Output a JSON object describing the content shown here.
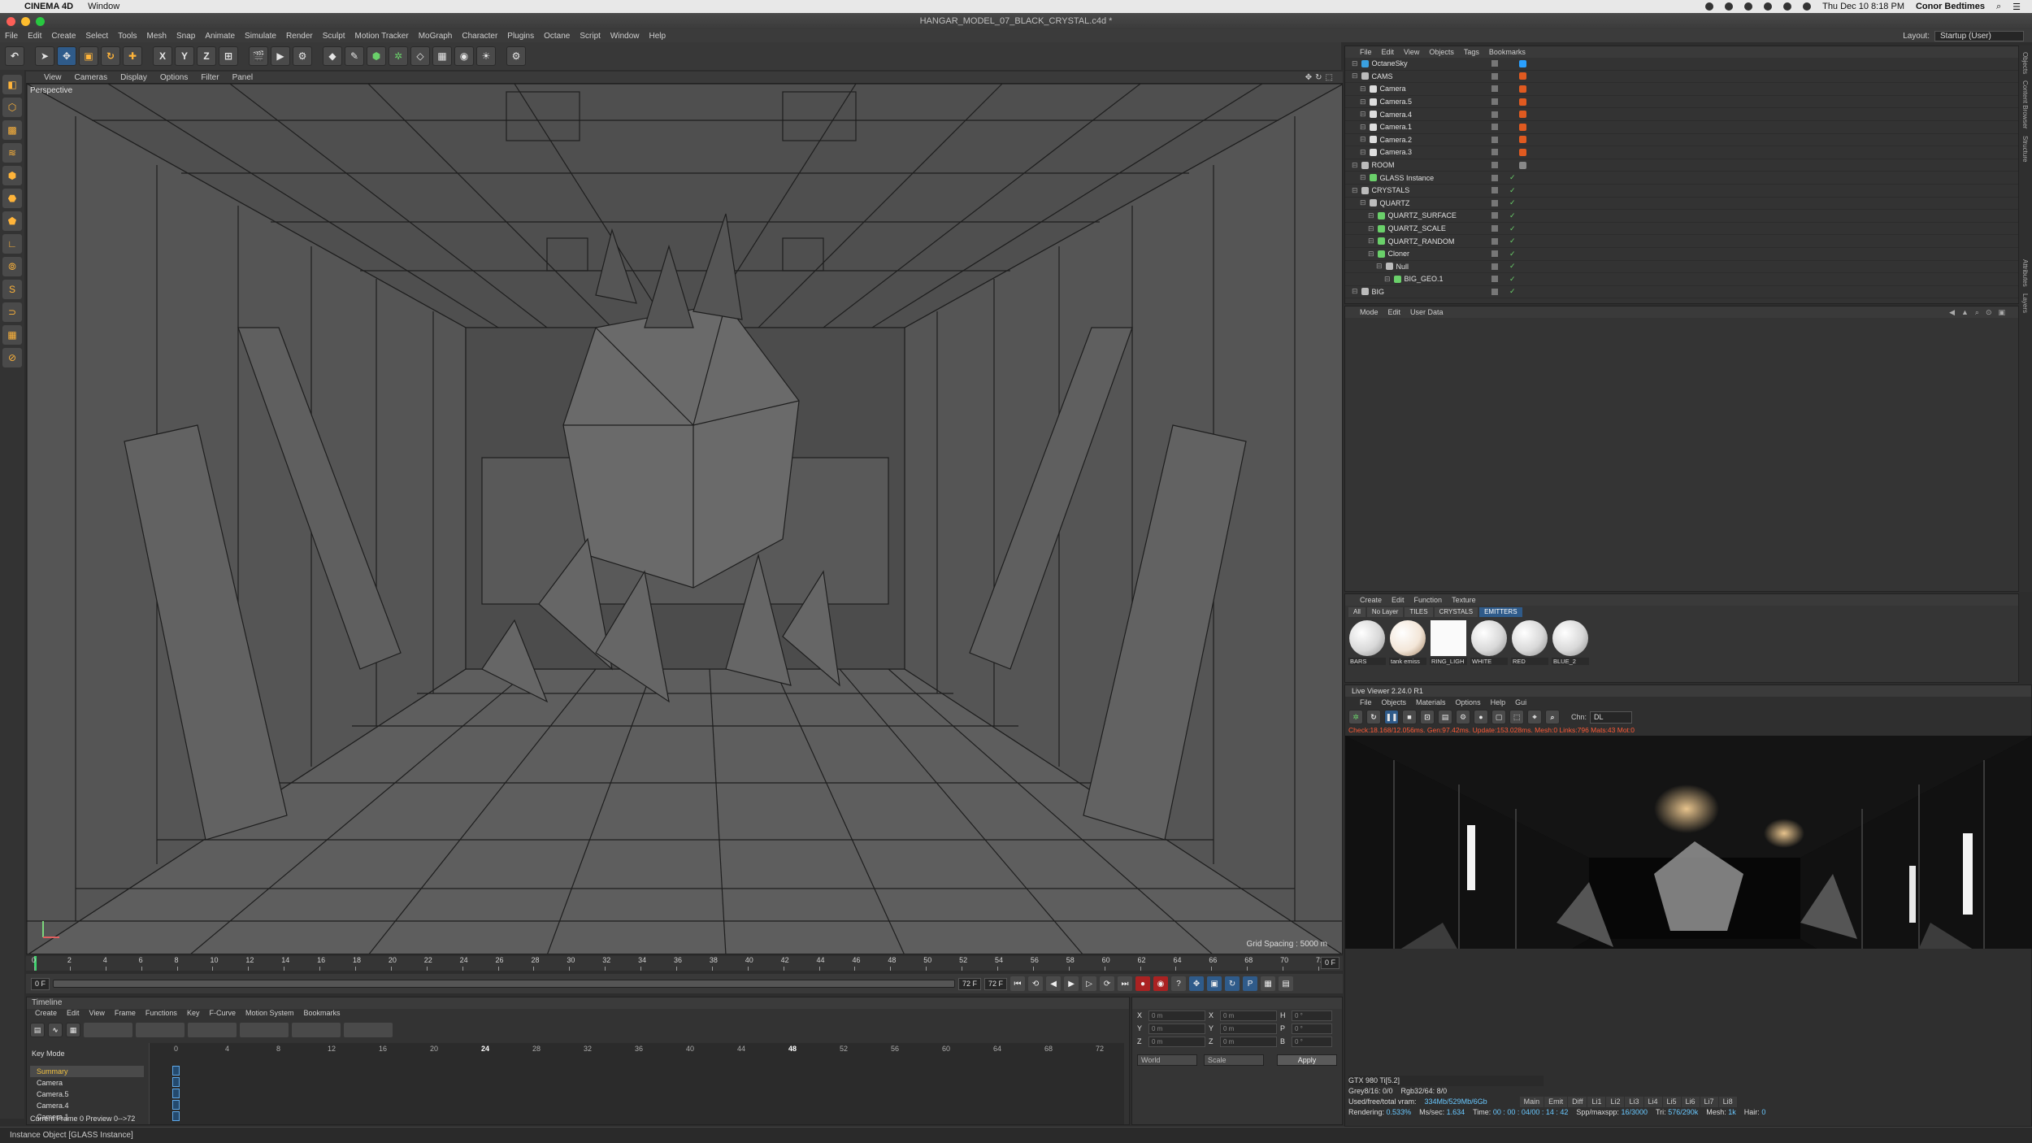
{
  "mac_menubar": {
    "app": "CINEMA 4D",
    "items": [
      "Window"
    ],
    "clock": "Thu Dec 10  8:18 PM",
    "user": "Conor Bedtimes"
  },
  "window": {
    "title": "HANGAR_MODEL_07_BLACK_CRYSTAL.c4d *"
  },
  "main_menu": {
    "items": [
      "File",
      "Edit",
      "Create",
      "Select",
      "Tools",
      "Mesh",
      "Snap",
      "Animate",
      "Simulate",
      "Render",
      "Sculpt",
      "Motion Tracker",
      "MoGraph",
      "Character",
      "Plugins",
      "Octane",
      "Script",
      "Window",
      "Help"
    ],
    "layout_label": "Layout:",
    "layout_value": "Startup (User)"
  },
  "toolbar": {
    "axis_buttons": [
      "X",
      "Y",
      "Z"
    ]
  },
  "viewport": {
    "menu": [
      "View",
      "Cameras",
      "Display",
      "Options",
      "Filter",
      "Panel"
    ],
    "label": "Perspective",
    "grid_spacing": "Grid Spacing : 5000 m"
  },
  "ruler": {
    "ticks": [
      "0",
      "2",
      "4",
      "6",
      "8",
      "10",
      "12",
      "14",
      "16",
      "18",
      "20",
      "22",
      "24",
      "26",
      "28",
      "30",
      "32",
      "34",
      "36",
      "38",
      "40",
      "42",
      "44",
      "46",
      "48",
      "50",
      "52",
      "54",
      "56",
      "58",
      "60",
      "62",
      "64",
      "66",
      "68",
      "70",
      "72"
    ],
    "current": "0 F"
  },
  "transport": {
    "start": "0 F",
    "current": "0 F",
    "end_a": "72 F",
    "end_b": "72 F"
  },
  "timeline": {
    "title": "Timeline",
    "menu": [
      "Create",
      "Edit",
      "View",
      "Frame",
      "Functions",
      "Key",
      "F-Curve",
      "Motion System",
      "Bookmarks"
    ],
    "key_mode": "Key Mode",
    "rows": [
      "Summary",
      "Camera",
      "Camera.5",
      "Camera.4",
      "Camera.1"
    ],
    "frames": [
      "0",
      "4",
      "8",
      "12",
      "16",
      "20",
      "24",
      "28",
      "32",
      "36",
      "40",
      "44",
      "48",
      "52",
      "56",
      "60",
      "64",
      "68",
      "72"
    ],
    "footer": "Current Frame  0  Preview  0-->72"
  },
  "coords": {
    "rows": [
      {
        "a": "X",
        "av": "0 m",
        "b": "X",
        "bv": "0 m",
        "c": "H",
        "cv": "0 °"
      },
      {
        "a": "Y",
        "av": "0 m",
        "b": "Y",
        "bv": "0 m",
        "c": "P",
        "cv": "0 °"
      },
      {
        "a": "Z",
        "av": "0 m",
        "b": "Z",
        "bv": "0 m",
        "c": "B",
        "cv": "0 °"
      }
    ],
    "mode_a": "World",
    "mode_b": "Scale",
    "apply": "Apply"
  },
  "status": "Instance Object [GLASS Instance]",
  "object_manager": {
    "menu": [
      "File",
      "Edit",
      "View",
      "Objects",
      "Tags",
      "Bookmarks"
    ],
    "objects": [
      {
        "name": "OctaneSky",
        "indent": 0,
        "color": "#3aa0e0",
        "tag": "#2aa0ff"
      },
      {
        "name": "CAMS",
        "indent": 0,
        "color": "#bbbbbb",
        "tag": "#e05a20"
      },
      {
        "name": "Camera",
        "indent": 1,
        "color": "#dddddd",
        "tag": "#e05a20"
      },
      {
        "name": "Camera.5",
        "indent": 1,
        "color": "#dddddd",
        "tag": "#e05a20"
      },
      {
        "name": "Camera.4",
        "indent": 1,
        "color": "#dddddd",
        "tag": "#e05a20"
      },
      {
        "name": "Camera.1",
        "indent": 1,
        "color": "#dddddd",
        "tag": "#e05a20"
      },
      {
        "name": "Camera.2",
        "indent": 1,
        "color": "#dddddd",
        "tag": "#e05a20"
      },
      {
        "name": "Camera.3",
        "indent": 1,
        "color": "#dddddd",
        "tag": "#e05a20"
      },
      {
        "name": "ROOM",
        "indent": 0,
        "color": "#bbbbbb",
        "tag": "#888888"
      },
      {
        "name": "GLASS Instance",
        "indent": 1,
        "color": "#6ad06a",
        "tag": ""
      },
      {
        "name": "CRYSTALS",
        "indent": 0,
        "color": "#bbbbbb",
        "tag": ""
      },
      {
        "name": "QUARTZ",
        "indent": 1,
        "color": "#bbbbbb",
        "tag": ""
      },
      {
        "name": "QUARTZ_SURFACE",
        "indent": 2,
        "color": "#6ad06a",
        "tag": ""
      },
      {
        "name": "QUARTZ_SCALE",
        "indent": 2,
        "color": "#6ad06a",
        "tag": ""
      },
      {
        "name": "QUARTZ_RANDOM",
        "indent": 2,
        "color": "#6ad06a",
        "tag": ""
      },
      {
        "name": "Cloner",
        "indent": 2,
        "color": "#6ad06a",
        "tag": ""
      },
      {
        "name": "Null",
        "indent": 3,
        "color": "#bbbbbb",
        "tag": ""
      },
      {
        "name": "BIG_GEO.1",
        "indent": 4,
        "color": "#6ad06a",
        "tag": ""
      },
      {
        "name": "BIG",
        "indent": 0,
        "color": "#bbbbbb",
        "tag": ""
      }
    ]
  },
  "attribute_manager": {
    "menu": [
      "Mode",
      "Edit",
      "User Data"
    ]
  },
  "material_manager": {
    "menu": [
      "Create",
      "Edit",
      "Function",
      "Texture"
    ],
    "tabs": [
      "All",
      "No Layer",
      "TILES",
      "CRYSTALS",
      "EMITTERS"
    ],
    "active_tab": "EMITTERS",
    "materials": [
      {
        "name": "BARS",
        "style": "ball"
      },
      {
        "name": "tank emiss",
        "style": "warm"
      },
      {
        "name": "RING_LIGH",
        "style": "flat"
      },
      {
        "name": "WHITE",
        "style": "ball"
      },
      {
        "name": "RED",
        "style": "ball"
      },
      {
        "name": "BLUE_2",
        "style": "ball"
      }
    ]
  },
  "live_viewer": {
    "title": "Live Viewer 2.24.0 R1",
    "menu": [
      "File",
      "Objects",
      "Materials",
      "Options",
      "Help",
      "Gui"
    ],
    "chn_label": "Chn:",
    "chn_value": "DL",
    "stats_line": "Check:18.168/12.056ms. Gen:97.42ms. Update:153.028ms. Mesh:0 Links:796 Mats:43 Mot:0",
    "gpu": "GTX 980 Ti[5.2]",
    "grey": "Grey8/16: 0/0",
    "rgb": "Rgb32/64: 8/0",
    "vram_label": "Used/free/total vram:",
    "vram_value": "334Mb/529Mb/6Gb",
    "tabs": [
      "Main",
      "Emit",
      "Diff",
      "Li1",
      "Li2",
      "Li3",
      "Li4",
      "Li5",
      "Li6",
      "Li7",
      "Li8"
    ],
    "rendering_label": "Rendering:",
    "rendering_value": "0.533%",
    "ms_label": "Ms/sec:",
    "ms_value": "1.634",
    "time_label": "Time:",
    "time_value": "00 : 00 : 04/00 : 14 : 42",
    "spp_label": "Spp/maxspp:",
    "spp_value": "16/3000",
    "tri_label": "Tri:",
    "tri_value": "576/290k",
    "mesh_label": "Mesh:",
    "mesh_value": "1k",
    "hair_label": "Hair:",
    "hair_value": "0"
  },
  "edge_tabs": [
    "Objects",
    "Content Browser",
    "Structure",
    "Attributes",
    "Layers"
  ]
}
